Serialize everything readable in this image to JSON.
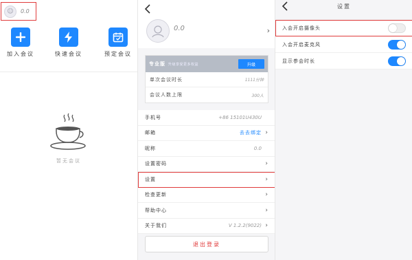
{
  "colors": {
    "accent": "#1e88ff",
    "highlight": "#e03b3b",
    "danger": "#e03b3b"
  },
  "home": {
    "user_name": "0.0",
    "actions": [
      {
        "label": "加入会议",
        "icon": "plus-icon"
      },
      {
        "label": "快速会议",
        "icon": "lightning-icon"
      },
      {
        "label": "预定会议",
        "icon": "calendar-icon"
      }
    ],
    "empty_text": "暂无会议"
  },
  "profile": {
    "user_name": "0.0",
    "card": {
      "title": "专业版",
      "desc": "升级享受更多权益",
      "button": "升级",
      "rows": [
        {
          "label": "单次会议时长",
          "value": "1111分钟"
        },
        {
          "label": "会议人数上限",
          "value": "300人"
        }
      ]
    },
    "rows": [
      {
        "label": "手机号",
        "value": "+86 15101U430U",
        "blue": false
      },
      {
        "label": "邮箱",
        "value": "去去绑定",
        "blue": true
      },
      {
        "label": "昵称",
        "value": "0.0",
        "blue": false
      },
      {
        "label": "设置密码",
        "value": "",
        "blue": false
      },
      {
        "label": "设置",
        "value": "",
        "blue": false
      },
      {
        "label": "检查更新",
        "value": "",
        "blue": false
      },
      {
        "label": "帮助中心",
        "value": "",
        "blue": false
      },
      {
        "label": "关于我们",
        "value": "V 1.2.2(9022)",
        "blue": false
      }
    ],
    "logout": "退出登录"
  },
  "settings": {
    "title": "设置",
    "rows": [
      {
        "label": "入会开启摄像头",
        "on": false
      },
      {
        "label": "入会开启麦克风",
        "on": true
      },
      {
        "label": "显示参会时长",
        "on": true
      }
    ]
  }
}
